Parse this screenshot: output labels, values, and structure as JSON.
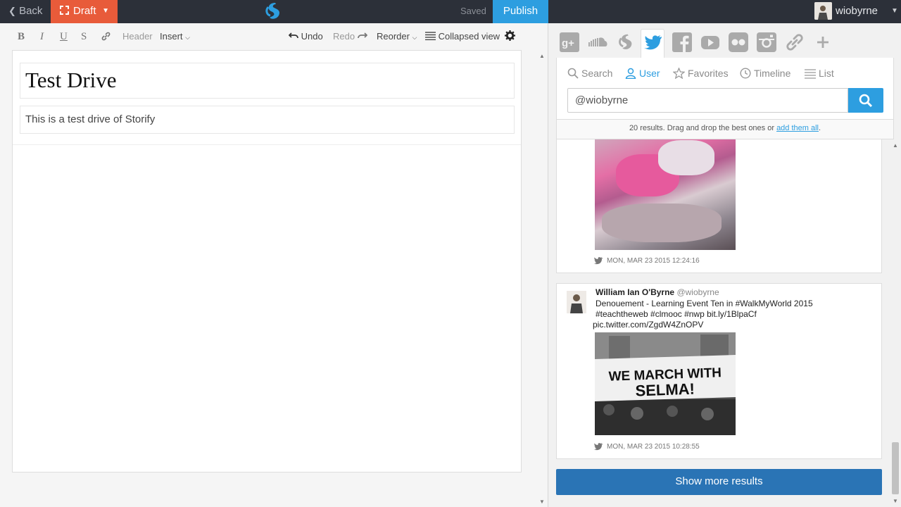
{
  "topbar": {
    "back_label": "Back",
    "draft_label": "Draft",
    "saved_label": "Saved",
    "publish_label": "Publish",
    "username": "wiobyrne"
  },
  "toolbar": {
    "bold": "B",
    "italic": "I",
    "underline": "U",
    "strike": "S",
    "header": "Header",
    "insert": "Insert",
    "undo": "Undo",
    "redo": "Redo",
    "reorder": "Reorder",
    "collapsed_view": "Collapsed view"
  },
  "story": {
    "title": "Test Drive",
    "description": "This is a test drive of Storify"
  },
  "sources": [
    "google-plus-icon",
    "soundcloud-icon",
    "storify-icon",
    "twitter-icon",
    "facebook-icon",
    "youtube-icon",
    "flickr-icon",
    "instagram-icon",
    "link-icon",
    "plus-icon"
  ],
  "search": {
    "tabs": [
      "Search",
      "User",
      "Favorites",
      "Timeline",
      "List"
    ],
    "active_tab": "User",
    "query": "@wiobyrne",
    "results_text": "20 results. Drag and drop the best ones or ",
    "add_all_label": "add them all",
    "results_suffix": "."
  },
  "results": [
    {
      "timestamp": "MON, MAR 23 2015 12:24:16"
    },
    {
      "author": "William Ian O'Byrne",
      "handle": "@wiobyrne",
      "text": "Denouement - Learning Event Ten in #WalkMyWorld 2015 #teachtheweb #clmooc #nwp bit.ly/1BlpaCf",
      "pic_link": "pic.twitter.com/ZgdW4ZnOPV",
      "image_banner": "WE MARCH WITH SELMA!",
      "timestamp": "MON, MAR 23 2015 10:28:55"
    }
  ],
  "show_more_label": "Show more results",
  "colors": {
    "topbar": "#2c3039",
    "draft": "#e85b3a",
    "publish": "#2d9ee0",
    "show_more": "#2a74b5"
  }
}
